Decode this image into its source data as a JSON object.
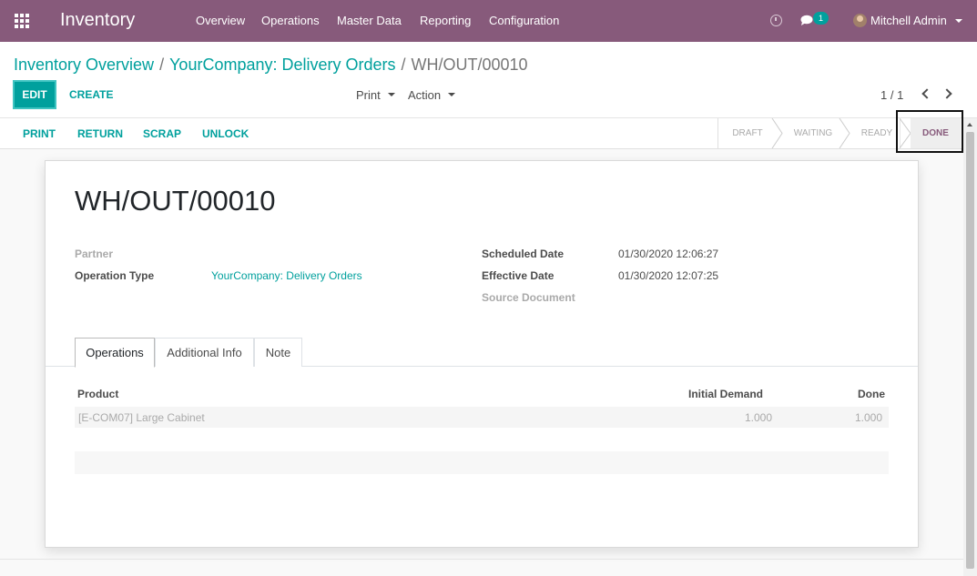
{
  "navbar": {
    "app_title": "Inventory",
    "menus": [
      "Overview",
      "Operations",
      "Master Data",
      "Reporting",
      "Configuration"
    ],
    "messages_count": "1",
    "user_name": "Mitchell Admin",
    "color": "#875a7b"
  },
  "breadcrumb": {
    "items": [
      "Inventory Overview",
      "YourCompany: Delivery Orders"
    ],
    "active": "WH/OUT/00010"
  },
  "buttons": {
    "edit": "EDIT",
    "create": "CREATE",
    "print_dd": "Print",
    "action_dd": "Action"
  },
  "pager": {
    "value": "1 / 1"
  },
  "statusbar": {
    "actions": [
      "PRINT",
      "RETURN",
      "SCRAP",
      "UNLOCK"
    ],
    "stages": [
      "DRAFT",
      "WAITING",
      "READY",
      "DONE"
    ],
    "current_stage": "DONE"
  },
  "record": {
    "name": "WH/OUT/00010",
    "partner_label": "Partner",
    "operation_type_label": "Operation Type",
    "operation_type_value": "YourCompany: Delivery Orders",
    "scheduled_date_label": "Scheduled Date",
    "scheduled_date_value": "01/30/2020 12:06:27",
    "effective_date_label": "Effective Date",
    "effective_date_value": "01/30/2020 12:07:25",
    "source_document_label": "Source Document"
  },
  "tabs": [
    "Operations",
    "Additional Info",
    "Note"
  ],
  "table": {
    "columns": [
      "Product",
      "Initial Demand",
      "Done"
    ],
    "rows": [
      {
        "product": "[E-COM07] Large Cabinet",
        "initial_demand": "1.000",
        "done": "1.000"
      }
    ]
  },
  "accent": "#00a09d"
}
